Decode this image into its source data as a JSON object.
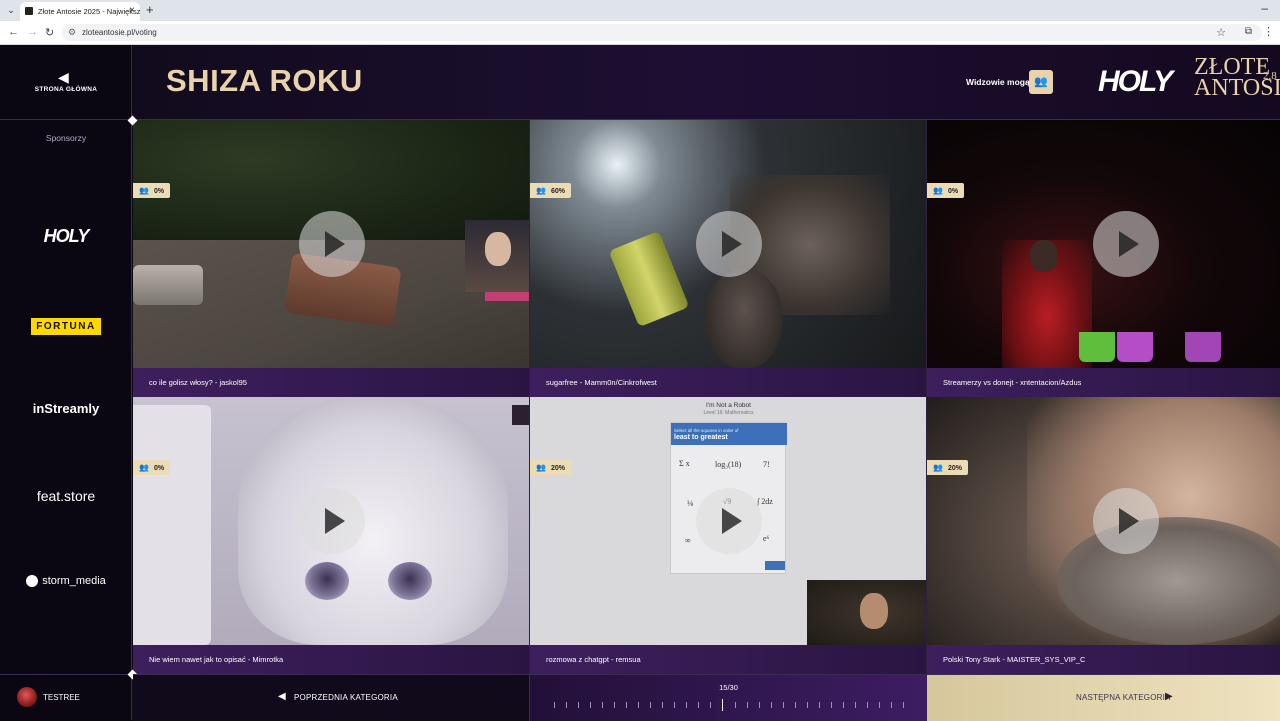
{
  "browser": {
    "tab_title": "Złote Antosie 2025 - Największ",
    "url": "zloteantosie.pl/voting"
  },
  "sidebar": {
    "home_label": "STRONA GŁÓWNA",
    "sponsors_title": "Sponsorzy",
    "sponsors": [
      "HOLY",
      "FORTUNA",
      "inStreamly",
      "feat.store",
      "storm_media"
    ],
    "user": "TESTREE"
  },
  "header": {
    "category_title": "SHIZA ROKU",
    "viewers_label": "Widzowie mogą",
    "logo_brand": "HOLY",
    "logo_title_line1": "ZŁOTE",
    "logo_title_line2": "ANTOSIE",
    "logo_year": "2.8"
  },
  "videos": [
    {
      "caption": "co ile golisz włosy? - jaskol95",
      "percent": "0%"
    },
    {
      "caption": "sugarfree - Mamm0n/Cinkrofwest",
      "percent": "60%"
    },
    {
      "caption": "Streamerzy vs donejt - xntentacion/Azdus",
      "percent": "0%"
    },
    {
      "caption": "Nie wiem nawet jak to opisać - Mimrotka",
      "percent": "0%"
    },
    {
      "caption": "rozmowa z chatgpt - remsua",
      "percent": "20%"
    },
    {
      "caption": "Polski Tony Stark - MAISTER_SYS_VIP_C",
      "percent": "20%"
    }
  ],
  "captcha": {
    "title": "I'm Not a Robot",
    "subtitle": "Level 16: Mathematics",
    "header_small": "Select all the squares in order of",
    "header_big": "least to greatest"
  },
  "navigation": {
    "prev_label": "POPRZEDNIA KATEGORIA",
    "next_label": "NASTĘPNA KATEGORIA",
    "progress_text": "15/30",
    "current": 15,
    "total": 30
  }
}
